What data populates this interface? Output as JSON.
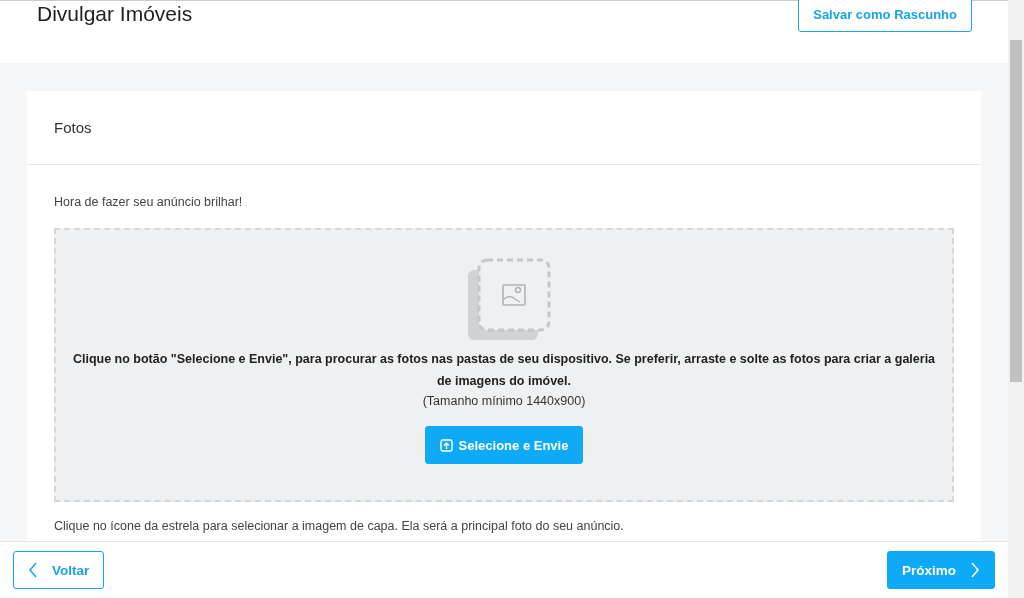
{
  "header": {
    "title": "Divulgar Imóveis",
    "draft_button": "Salvar como Rascunho"
  },
  "card": {
    "title": "Fotos",
    "intro": "Hora de fazer seu anúncio brilhar!",
    "dropzone": {
      "instructions": "Clique no botão \"Selecione e Envie\", para procurar as fotos nas pastas de seu dispositivo. Se preferir, arraste e solte as fotos para criar a galeria de imagens do imóvel.",
      "size_hint": "(Tamanho mínimo 1440x900)",
      "upload_button": "Selecione e Envie"
    },
    "cover_hint": "Clique no ícone da estrela para selecionar a imagem de capa. Ela será a principal foto do seu anúncio."
  },
  "footer": {
    "back_button": "Voltar",
    "next_button": "Próximo"
  }
}
